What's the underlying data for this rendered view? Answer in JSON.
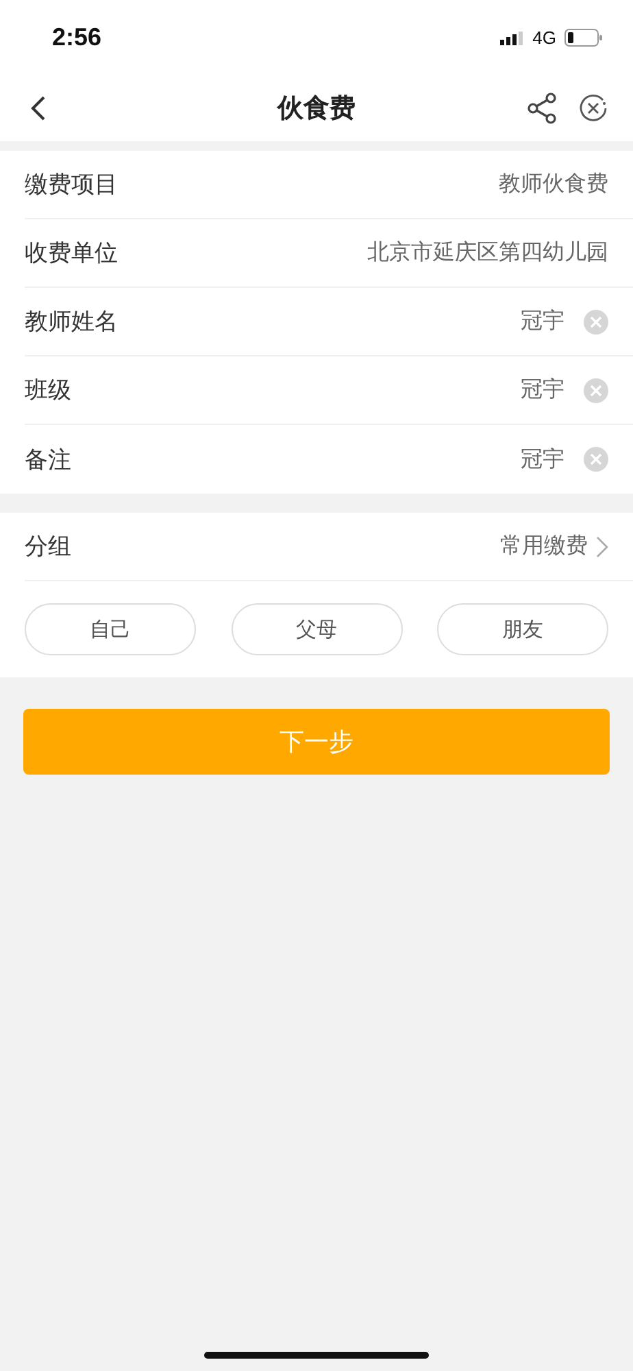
{
  "status_bar": {
    "time": "2:56",
    "network": "4G"
  },
  "nav": {
    "title": "伙食费"
  },
  "fields": [
    {
      "label": "缴费项目",
      "value": "教师伙食费",
      "kind": "text"
    },
    {
      "label": "收费单位",
      "value": "北京市延庆区第四幼儿园",
      "kind": "text"
    },
    {
      "label": "教师姓名",
      "value": "冠宇",
      "kind": "clearable"
    },
    {
      "label": "班级",
      "value": "冠宇",
      "kind": "clearable"
    },
    {
      "label": "备注",
      "value": "冠宇",
      "kind": "clearable"
    }
  ],
  "group": {
    "label": "分组",
    "value": "常用缴费",
    "options": [
      {
        "label": "自己",
        "selected": false
      },
      {
        "label": "父母",
        "selected": false
      },
      {
        "label": "朋友",
        "selected": false
      }
    ]
  },
  "next_button": "下一步"
}
